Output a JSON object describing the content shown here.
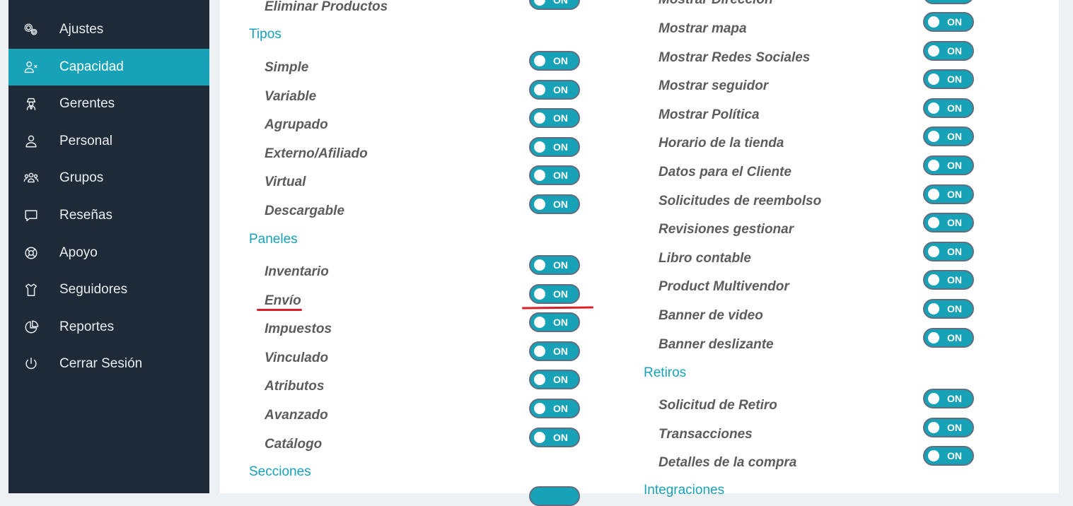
{
  "sidebar": {
    "items": [
      {
        "label": "Ajustes",
        "icon": "gears-icon"
      },
      {
        "label": "Capacidad",
        "icon": "user-x-icon",
        "active": true
      },
      {
        "label": "Gerentes",
        "icon": "manager-icon"
      },
      {
        "label": "Personal",
        "icon": "user-icon"
      },
      {
        "label": "Grupos",
        "icon": "users-icon"
      },
      {
        "label": "Reseñas",
        "icon": "chat-icon"
      },
      {
        "label": "Apoyo",
        "icon": "lifebuoy-icon"
      },
      {
        "label": "Seguidores",
        "icon": "shirt-icon"
      },
      {
        "label": "Reportes",
        "icon": "pie-chart-icon"
      },
      {
        "label": "Cerrar Sesión",
        "icon": "power-icon"
      }
    ]
  },
  "toggle_text": "ON",
  "left_column": {
    "top_item": "Eliminar Productos",
    "tipos": {
      "title": "Tipos",
      "items": [
        "Simple",
        "Variable",
        "Agrupado",
        "Externo/Afiliado",
        "Virtual",
        "Descargable"
      ]
    },
    "paneles": {
      "title": "Paneles",
      "items": [
        "Inventario",
        "Envío",
        "Impuestos",
        "Vinculado",
        "Atributos",
        "Avanzado",
        "Catálogo"
      ]
    },
    "secciones": {
      "title": "Secciones"
    }
  },
  "right_column": {
    "top_item": "Mostrar Dirección",
    "items": [
      "Mostrar mapa",
      "Mostrar Redes Sociales",
      "Mostrar seguidor",
      "Mostrar Política",
      "Horario de la tienda",
      "Datos para el Cliente",
      "Solicitudes de reembolso",
      "Revisiones gestionar",
      "Libro contable",
      "Product Multivendor",
      "Banner de video",
      "Banner deslizante"
    ],
    "retiros": {
      "title": "Retiros",
      "items": [
        "Solicitud de Retiro",
        "Transacciones",
        "Detalles de la compra"
      ]
    },
    "integraciones": {
      "title": "Integraciones"
    }
  },
  "colors": {
    "accent": "#17a2b8",
    "sidebar_bg": "#1e2a38",
    "annotation": "#d9202a"
  }
}
